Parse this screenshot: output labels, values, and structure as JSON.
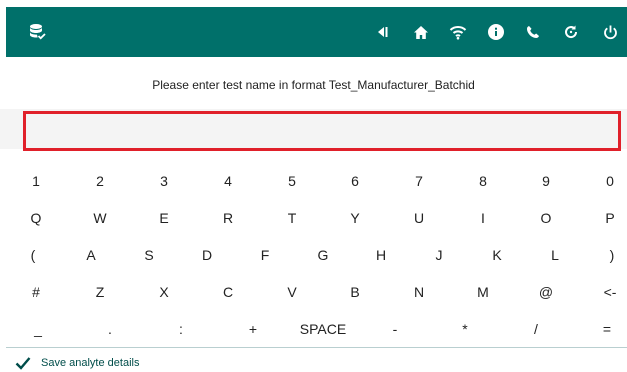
{
  "colors": {
    "header_bg": "#00706a",
    "accent": "#00706a",
    "highlight_border": "#e0202a"
  },
  "header": {
    "left_icon": "database-check-icon",
    "right_icons": [
      "skip-back-icon",
      "home-icon",
      "wifi-icon",
      "info-icon",
      "phone-icon",
      "refresh-icon",
      "power-icon"
    ]
  },
  "prompt": "Please enter test name in format Test_Manufacturer_Batchid",
  "input": {
    "value": "",
    "placeholder": ""
  },
  "keyboard": {
    "rows": [
      [
        "1",
        "2",
        "3",
        "4",
        "5",
        "6",
        "7",
        "8",
        "9",
        "0"
      ],
      [
        "Q",
        "W",
        "E",
        "R",
        "T",
        "Y",
        "U",
        "I",
        "O",
        "P"
      ],
      [
        "(",
        "A",
        "S",
        "D",
        "F",
        "G",
        "H",
        "J",
        "K",
        "L",
        ")"
      ],
      [
        "#",
        "Z",
        "X",
        "C",
        "V",
        "B",
        "N",
        "M",
        "@",
        "<-"
      ],
      [
        "_",
        ".",
        ":",
        "+",
        "SPACE",
        "-",
        "*",
        "/",
        "="
      ]
    ]
  },
  "footer": {
    "icon": "checkmark-icon",
    "label": "Save analyte details"
  }
}
